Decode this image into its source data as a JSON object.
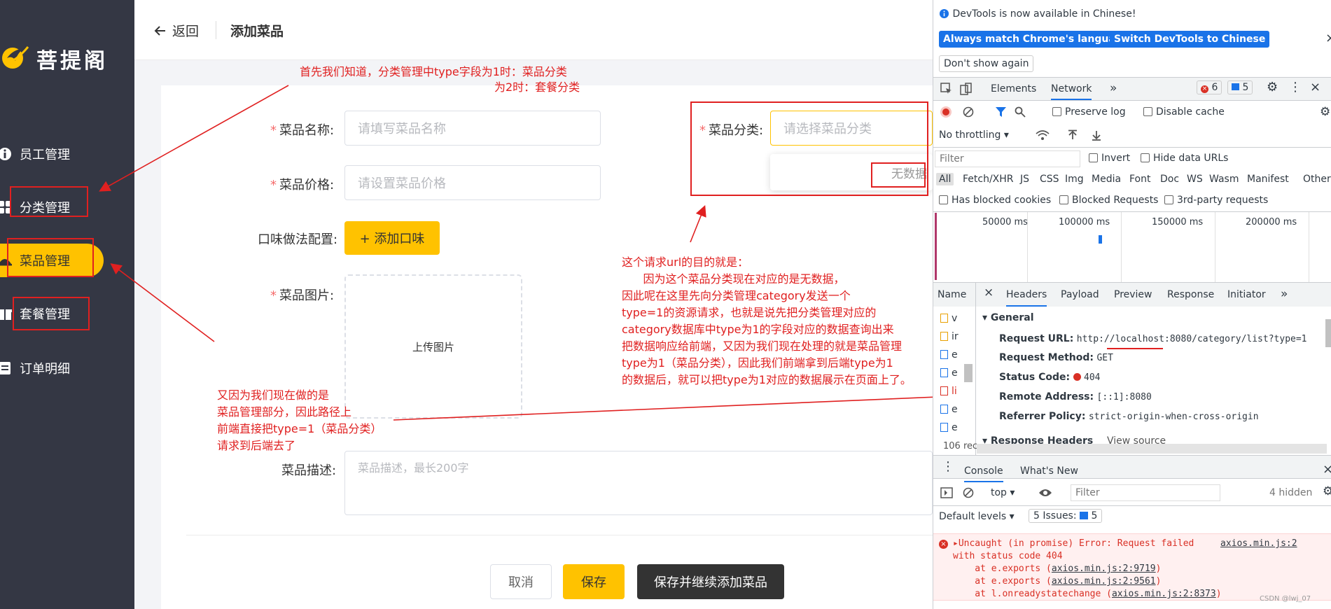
{
  "app": {
    "logo_text": "菩提阁"
  },
  "sidebar": {
    "items": [
      {
        "label": "员工管理",
        "icon": "employee-icon"
      },
      {
        "label": "分类管理",
        "icon": "category-icon"
      },
      {
        "label": "菜品管理",
        "icon": "dish-icon",
        "active": true
      },
      {
        "label": "套餐管理",
        "icon": "setmeal-icon"
      },
      {
        "label": "订单明细",
        "icon": "order-icon"
      }
    ]
  },
  "topbar": {
    "back_label": "返回",
    "title": "添加菜品"
  },
  "form": {
    "name_label": "菜品名称:",
    "name_placeholder": "请填写菜品名称",
    "price_label": "菜品价格:",
    "price_placeholder": "请设置菜品价格",
    "category_label": "菜品分类:",
    "category_placeholder": "请选择菜品分类",
    "category_empty": "无数据",
    "flavor_label": "口味做法配置:",
    "flavor_button": "+ 添加口味",
    "image_label": "菜品图片:",
    "upload_text": "上传图片",
    "desc_label": "菜品描述:",
    "desc_placeholder": "菜品描述，最长200字",
    "cancel_button": "取消",
    "save_button": "保存",
    "save_continue_button": "保存并继续添加菜品"
  },
  "annotations": {
    "note1_line1": "首先我们知道，分类管理中type字段为1时：菜品分类",
    "note1_line2": "为2时：套餐分类",
    "note2": [
      "这个请求url的目的就是：",
      "      因为这个菜品分类现在对应的是无数据，",
      "因此呢在这里先向分类管理category发送一个",
      "type=1的资源请求，也就是说先把分类管理对应的",
      "category数据库中type为1的字段对应的数据查询出来",
      "把数据响应给前端，又因为我们现在处理的就是菜品管理",
      "type为1（菜品分类），因此我们前端拿到后端type为1",
      "的数据后，就可以把type为1对应的数据展示在页面上了。"
    ],
    "note3": [
      "又因为我们现在做的是",
      "菜品管理部分，因此路径上",
      "前端直接把type=1（菜品分类）",
      "请求到后端去了"
    ]
  },
  "devtools": {
    "banner_text": "DevTools is now available in Chinese!",
    "btn_match": "Always match Chrome's language",
    "btn_switch": "Switch DevTools to Chinese",
    "btn_dont_show": "Don't show again",
    "tabs": [
      "Elements",
      "Network"
    ],
    "error_count": "6",
    "message_count": "5",
    "preserve_log": "Preserve log",
    "disable_cache": "Disable cache",
    "throttling": "No throttling",
    "filter_placeholder": "Filter",
    "invert": "Invert",
    "hide_data_urls": "Hide data URLs",
    "type_filters": [
      "All",
      "Fetch/XHR",
      "JS",
      "CSS",
      "Img",
      "Media",
      "Font",
      "Doc",
      "WS",
      "Wasm",
      "Manifest",
      "Other"
    ],
    "blocked_cookies": "Has blocked cookies",
    "blocked_requests": "Blocked Requests",
    "third_party": "3rd-party requests",
    "timeline_ticks": [
      "50000 ms",
      "100000 ms",
      "150000 ms",
      "200000 ms"
    ],
    "name_header": "Name",
    "detail_tabs": [
      "Headers",
      "Payload",
      "Preview",
      "Response",
      "Initiator"
    ],
    "name_rows": [
      "v",
      "ir",
      "e",
      "e",
      "li",
      "e",
      "e"
    ],
    "requests_count": "106 rec",
    "general_title": "General",
    "request_url_key": "Request URL:",
    "request_url_val": "http://localhost:8080/category/list?type=1",
    "request_method_key": "Request Method:",
    "request_method_val": "GET",
    "status_code_key": "Status Code:",
    "status_code_val": "404",
    "remote_address_key": "Remote Address:",
    "remote_address_val": "[::1]:8080",
    "referrer_policy_key": "Referrer Policy:",
    "referrer_policy_val": "strict-origin-when-cross-origin",
    "response_headers": "Response Headers",
    "view_source": "View source",
    "console_tab": "Console",
    "whats_new_tab": "What's New",
    "context": "top",
    "console_filter": "Filter",
    "hidden_count": "4 hidden",
    "default_levels": "Default levels",
    "issues": "5 Issues:",
    "issues_count": "5",
    "error_lines": [
      "Uncaught (in promise) Error: Request failed",
      "with status code 404",
      "    at e.exports (",
      "    at e.exports (",
      "    at l.onreadystatechange ("
    ],
    "error_src": [
      "axios.min.js:2",
      "axios.min.js:2:9719",
      "axios.min.js:2:9561",
      "axios.min.js:2:8373"
    ],
    "watermark": "CSDN @lwj_07"
  }
}
